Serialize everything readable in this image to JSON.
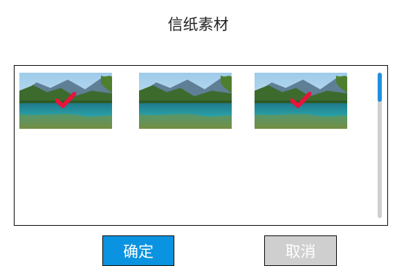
{
  "dialog": {
    "title": "信纸素材",
    "confirm_label": "确定",
    "cancel_label": "取消"
  },
  "thumbnails": [
    {
      "selected": true
    },
    {
      "selected": false
    },
    {
      "selected": true
    }
  ],
  "colors": {
    "accent": "#0a93e0",
    "cancel_bg": "#cfcfcf",
    "check": "#e8143c"
  },
  "icons": {
    "check": "checkmark-icon"
  }
}
